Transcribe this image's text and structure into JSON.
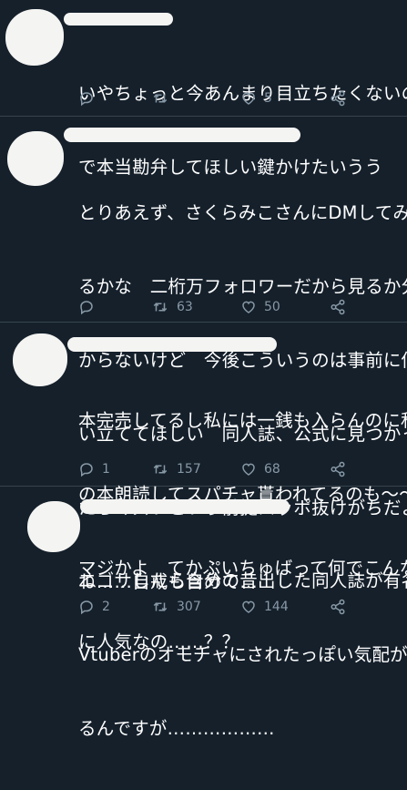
{
  "tweets": [
    {
      "lines": [
        "いやちょっと今あんまり目立ちたくないの",
        "で本当勘弁してほしい鍵かけたいうう"
      ],
      "reply_count": "",
      "retweet_count": "",
      "like_count": "5"
    },
    {
      "lines": [
        "とりあえず、さくらみこさんにDMしてみ",
        "るかな　二桁万フォロワーだから見るか分",
        "からないけど　今後こういうのは事前に伺",
        "い立ててほしい　同人誌、公式に見つかっ",
        "たらマズいという前提スッポ抜けがちだよ",
        "ね……自戒も含めて…"
      ],
      "reply_count": "",
      "retweet_count": "63",
      "like_count": "50"
    },
    {
      "lines": [
        "本完売してるし私には一銭も入らんのに私",
        "の本朗読してスパチャ貰われてるのも〜〜",
        "マジかよ　てかぷいちゅばって何でこんな",
        "に人気なの……？？"
      ],
      "reply_count": "1",
      "retweet_count": "157",
      "like_count": "68"
    },
    {
      "lines": [
        "エゴサしたら自分の昔出した同人誌が有名",
        "Vtuberのオモチャにされたっぽい気配がす",
        "るんですが………………"
      ],
      "reply_count": "2",
      "retweet_count": "307",
      "like_count": "144"
    }
  ],
  "icons": {
    "reply": "reply-icon",
    "retweet": "retweet-icon",
    "like": "like-icon",
    "share": "share-icon"
  },
  "colors": {
    "background": "#15202b",
    "text": "#ffffff",
    "muted": "#8899a6",
    "divider": "#38444d",
    "redaction": "#f4f4f2"
  }
}
